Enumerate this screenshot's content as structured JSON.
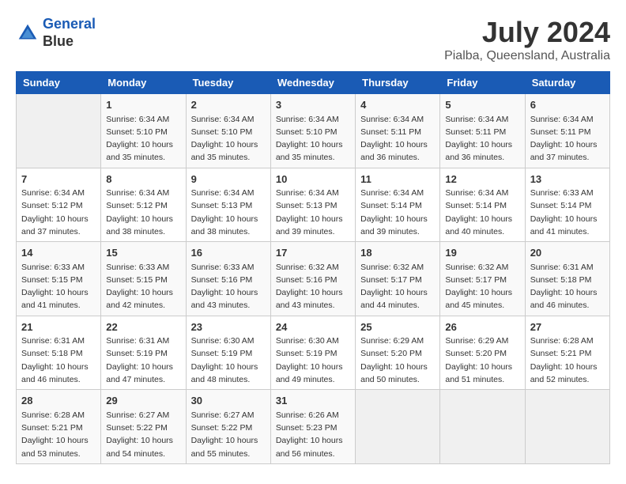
{
  "header": {
    "logo_line1": "General",
    "logo_line2": "Blue",
    "month_year": "July 2024",
    "location": "Pialba, Queensland, Australia"
  },
  "weekdays": [
    "Sunday",
    "Monday",
    "Tuesday",
    "Wednesday",
    "Thursday",
    "Friday",
    "Saturday"
  ],
  "weeks": [
    [
      {
        "day": "",
        "sunrise": "",
        "sunset": "",
        "daylight": ""
      },
      {
        "day": "1",
        "sunrise": "Sunrise: 6:34 AM",
        "sunset": "Sunset: 5:10 PM",
        "daylight": "Daylight: 10 hours and 35 minutes."
      },
      {
        "day": "2",
        "sunrise": "Sunrise: 6:34 AM",
        "sunset": "Sunset: 5:10 PM",
        "daylight": "Daylight: 10 hours and 35 minutes."
      },
      {
        "day": "3",
        "sunrise": "Sunrise: 6:34 AM",
        "sunset": "Sunset: 5:10 PM",
        "daylight": "Daylight: 10 hours and 35 minutes."
      },
      {
        "day": "4",
        "sunrise": "Sunrise: 6:34 AM",
        "sunset": "Sunset: 5:11 PM",
        "daylight": "Daylight: 10 hours and 36 minutes."
      },
      {
        "day": "5",
        "sunrise": "Sunrise: 6:34 AM",
        "sunset": "Sunset: 5:11 PM",
        "daylight": "Daylight: 10 hours and 36 minutes."
      },
      {
        "day": "6",
        "sunrise": "Sunrise: 6:34 AM",
        "sunset": "Sunset: 5:11 PM",
        "daylight": "Daylight: 10 hours and 37 minutes."
      }
    ],
    [
      {
        "day": "7",
        "sunrise": "Sunrise: 6:34 AM",
        "sunset": "Sunset: 5:12 PM",
        "daylight": "Daylight: 10 hours and 37 minutes."
      },
      {
        "day": "8",
        "sunrise": "Sunrise: 6:34 AM",
        "sunset": "Sunset: 5:12 PM",
        "daylight": "Daylight: 10 hours and 38 minutes."
      },
      {
        "day": "9",
        "sunrise": "Sunrise: 6:34 AM",
        "sunset": "Sunset: 5:13 PM",
        "daylight": "Daylight: 10 hours and 38 minutes."
      },
      {
        "day": "10",
        "sunrise": "Sunrise: 6:34 AM",
        "sunset": "Sunset: 5:13 PM",
        "daylight": "Daylight: 10 hours and 39 minutes."
      },
      {
        "day": "11",
        "sunrise": "Sunrise: 6:34 AM",
        "sunset": "Sunset: 5:14 PM",
        "daylight": "Daylight: 10 hours and 39 minutes."
      },
      {
        "day": "12",
        "sunrise": "Sunrise: 6:34 AM",
        "sunset": "Sunset: 5:14 PM",
        "daylight": "Daylight: 10 hours and 40 minutes."
      },
      {
        "day": "13",
        "sunrise": "Sunrise: 6:33 AM",
        "sunset": "Sunset: 5:14 PM",
        "daylight": "Daylight: 10 hours and 41 minutes."
      }
    ],
    [
      {
        "day": "14",
        "sunrise": "Sunrise: 6:33 AM",
        "sunset": "Sunset: 5:15 PM",
        "daylight": "Daylight: 10 hours and 41 minutes."
      },
      {
        "day": "15",
        "sunrise": "Sunrise: 6:33 AM",
        "sunset": "Sunset: 5:15 PM",
        "daylight": "Daylight: 10 hours and 42 minutes."
      },
      {
        "day": "16",
        "sunrise": "Sunrise: 6:33 AM",
        "sunset": "Sunset: 5:16 PM",
        "daylight": "Daylight: 10 hours and 43 minutes."
      },
      {
        "day": "17",
        "sunrise": "Sunrise: 6:32 AM",
        "sunset": "Sunset: 5:16 PM",
        "daylight": "Daylight: 10 hours and 43 minutes."
      },
      {
        "day": "18",
        "sunrise": "Sunrise: 6:32 AM",
        "sunset": "Sunset: 5:17 PM",
        "daylight": "Daylight: 10 hours and 44 minutes."
      },
      {
        "day": "19",
        "sunrise": "Sunrise: 6:32 AM",
        "sunset": "Sunset: 5:17 PM",
        "daylight": "Daylight: 10 hours and 45 minutes."
      },
      {
        "day": "20",
        "sunrise": "Sunrise: 6:31 AM",
        "sunset": "Sunset: 5:18 PM",
        "daylight": "Daylight: 10 hours and 46 minutes."
      }
    ],
    [
      {
        "day": "21",
        "sunrise": "Sunrise: 6:31 AM",
        "sunset": "Sunset: 5:18 PM",
        "daylight": "Daylight: 10 hours and 46 minutes."
      },
      {
        "day": "22",
        "sunrise": "Sunrise: 6:31 AM",
        "sunset": "Sunset: 5:19 PM",
        "daylight": "Daylight: 10 hours and 47 minutes."
      },
      {
        "day": "23",
        "sunrise": "Sunrise: 6:30 AM",
        "sunset": "Sunset: 5:19 PM",
        "daylight": "Daylight: 10 hours and 48 minutes."
      },
      {
        "day": "24",
        "sunrise": "Sunrise: 6:30 AM",
        "sunset": "Sunset: 5:19 PM",
        "daylight": "Daylight: 10 hours and 49 minutes."
      },
      {
        "day": "25",
        "sunrise": "Sunrise: 6:29 AM",
        "sunset": "Sunset: 5:20 PM",
        "daylight": "Daylight: 10 hours and 50 minutes."
      },
      {
        "day": "26",
        "sunrise": "Sunrise: 6:29 AM",
        "sunset": "Sunset: 5:20 PM",
        "daylight": "Daylight: 10 hours and 51 minutes."
      },
      {
        "day": "27",
        "sunrise": "Sunrise: 6:28 AM",
        "sunset": "Sunset: 5:21 PM",
        "daylight": "Daylight: 10 hours and 52 minutes."
      }
    ],
    [
      {
        "day": "28",
        "sunrise": "Sunrise: 6:28 AM",
        "sunset": "Sunset: 5:21 PM",
        "daylight": "Daylight: 10 hours and 53 minutes."
      },
      {
        "day": "29",
        "sunrise": "Sunrise: 6:27 AM",
        "sunset": "Sunset: 5:22 PM",
        "daylight": "Daylight: 10 hours and 54 minutes."
      },
      {
        "day": "30",
        "sunrise": "Sunrise: 6:27 AM",
        "sunset": "Sunset: 5:22 PM",
        "daylight": "Daylight: 10 hours and 55 minutes."
      },
      {
        "day": "31",
        "sunrise": "Sunrise: 6:26 AM",
        "sunset": "Sunset: 5:23 PM",
        "daylight": "Daylight: 10 hours and 56 minutes."
      },
      {
        "day": "",
        "sunrise": "",
        "sunset": "",
        "daylight": ""
      },
      {
        "day": "",
        "sunrise": "",
        "sunset": "",
        "daylight": ""
      },
      {
        "day": "",
        "sunrise": "",
        "sunset": "",
        "daylight": ""
      }
    ]
  ]
}
